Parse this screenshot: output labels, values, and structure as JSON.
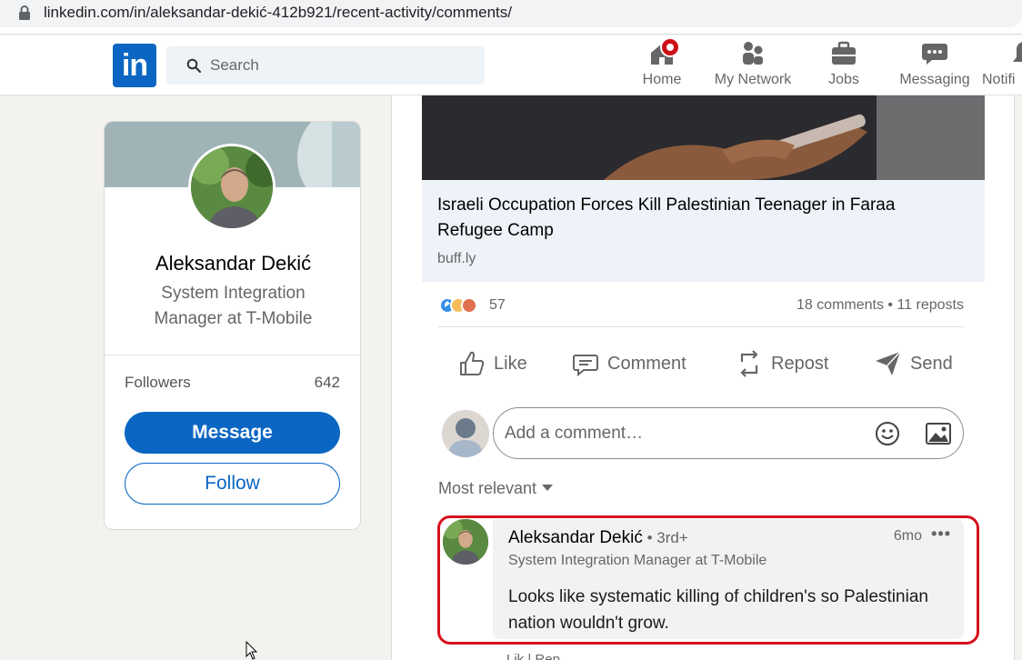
{
  "browser": {
    "url": "linkedin.com/in/aleksandar-dekić-412b921/recent-activity/comments/"
  },
  "nav": {
    "logo_text": "in",
    "search_placeholder": "Search",
    "items": [
      {
        "label": "Home",
        "icon": "home-icon"
      },
      {
        "label": "My Network",
        "icon": "network-icon"
      },
      {
        "label": "Jobs",
        "icon": "briefcase-icon"
      },
      {
        "label": "Messaging",
        "icon": "messaging-icon"
      },
      {
        "label": "Notifi",
        "icon": "bell-icon"
      }
    ],
    "brand_color": "#0a66c2",
    "badge_color": "#cc1016"
  },
  "profile": {
    "name": "Aleksandar Dekić",
    "title": "System Integration Manager at T-Mobile",
    "followers_label": "Followers",
    "followers_count": "642",
    "message_label": "Message",
    "follow_label": "Follow"
  },
  "post": {
    "link_title": "Israeli Occupation Forces Kill Palestinian Teenager in Faraa Refugee Camp",
    "link_source": "buff.ly",
    "reaction_count": "57",
    "comments_reposts": "18 comments • 11 reposts",
    "actions": {
      "like": "Like",
      "comment": "Comment",
      "repost": "Repost",
      "send": "Send"
    },
    "comment_placeholder": "Add a comment…",
    "sort_label": "Most relevant"
  },
  "comment": {
    "author": "Aleksandar Dekić",
    "degree": " • 3rd+",
    "time": "6mo",
    "more": "•••",
    "headline": "System Integration Manager at T-Mobile",
    "text": "Looks like systematic killing of children's so Palestinian nation wouldn't grow.",
    "highlight_color": "#d6101c",
    "partial_actions": "Lik   |   Rep"
  }
}
